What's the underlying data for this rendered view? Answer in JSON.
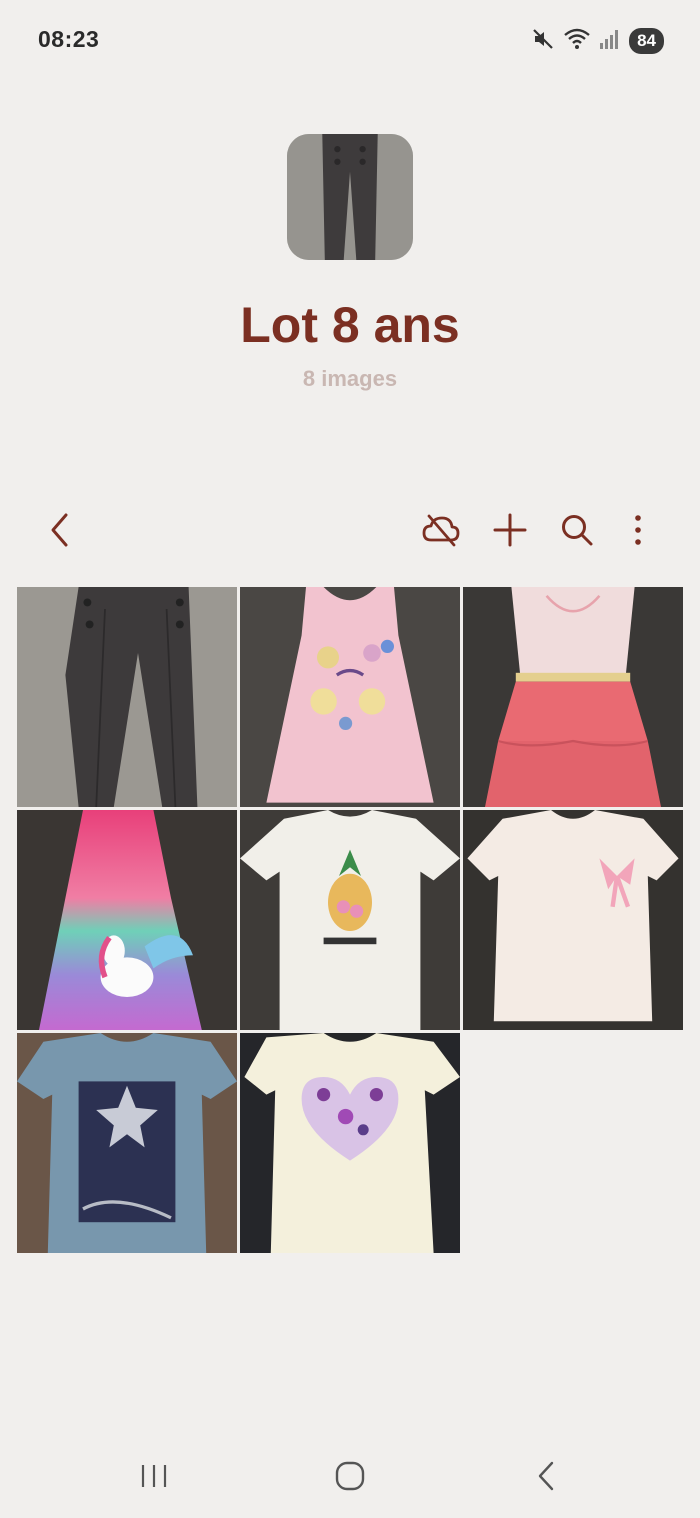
{
  "status_bar": {
    "time": "08:23",
    "battery": "84",
    "icons": [
      "mute-icon",
      "wifi-icon",
      "signal-icon"
    ]
  },
  "album": {
    "title": "Lot 8 ans",
    "count_label": "8 images",
    "cover": "dark-pants-thumbnail"
  },
  "toolbar": {
    "back_icon": "chevron-left-icon",
    "actions": [
      "cloud-off-icon",
      "add-icon",
      "search-icon",
      "more-vert-icon"
    ],
    "accent_color": "#7b2f22"
  },
  "photos": [
    {
      "subject": "dark grey pants"
    },
    {
      "subject": "pink tank dress with mermaid print"
    },
    {
      "subject": "pink dress with ruffled skirt"
    },
    {
      "subject": "rainbow glitter dress with unicorn"
    },
    {
      "subject": "white t-shirt with pineapple"
    },
    {
      "subject": "white t-shirt with pink bow"
    },
    {
      "subject": "blue t-shirt with sequin star"
    },
    {
      "subject": "cream t-shirt with sea-creature heart"
    }
  ],
  "nav_bar": {
    "buttons": [
      "recent-apps-icon",
      "home-icon",
      "back-icon"
    ]
  }
}
